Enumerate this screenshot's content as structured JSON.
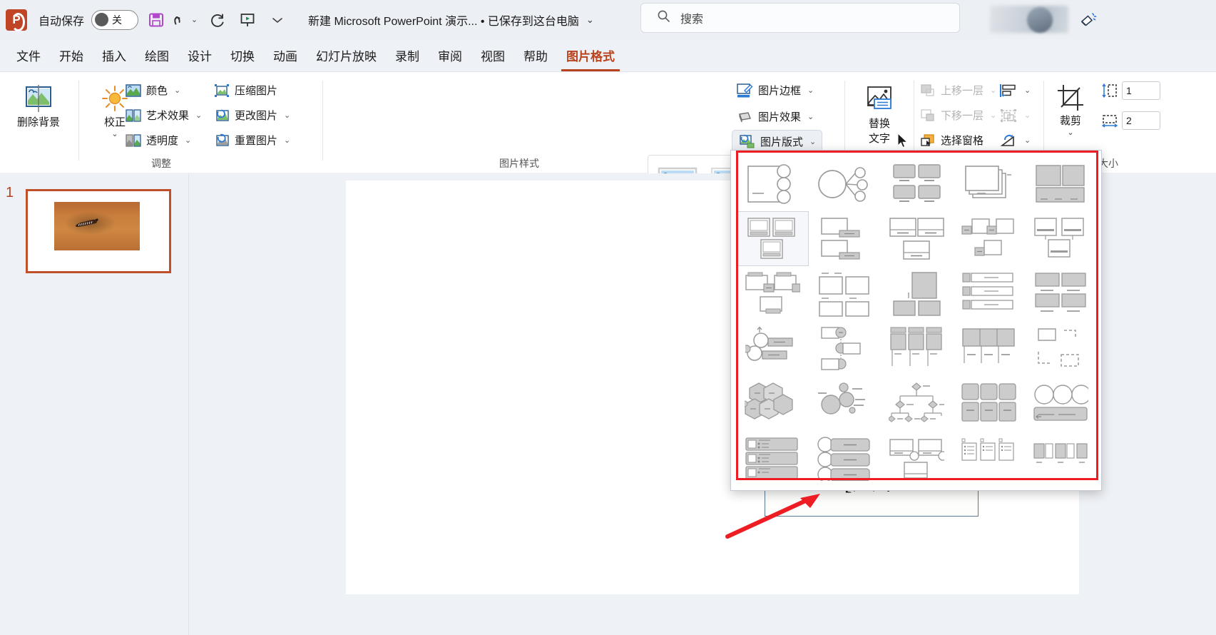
{
  "titlebar": {
    "app_logo": "powerpoint-logo",
    "autosave_label": "自动保存",
    "autosave_state": "关",
    "save_icon": "save-icon",
    "undo_icon": "undo-icon",
    "redo_icon": "redo-icon",
    "present_icon": "start-presentation-icon",
    "customize_icon": "customize-quick-access-icon",
    "document_title": "新建 Microsoft PowerPoint 演示... • 已保存到这台电脑",
    "title_caret": "chevron-down-icon",
    "account_icon": "account-avatar",
    "megaphone_icon": "announcements-icon"
  },
  "search": {
    "placeholder": "搜索",
    "icon": "search-icon"
  },
  "tabs": [
    {
      "label": "文件",
      "active": false
    },
    {
      "label": "开始",
      "active": false
    },
    {
      "label": "插入",
      "active": false
    },
    {
      "label": "绘图",
      "active": false
    },
    {
      "label": "设计",
      "active": false
    },
    {
      "label": "切换",
      "active": false
    },
    {
      "label": "动画",
      "active": false
    },
    {
      "label": "幻灯片放映",
      "active": false
    },
    {
      "label": "录制",
      "active": false
    },
    {
      "label": "审阅",
      "active": false
    },
    {
      "label": "视图",
      "active": false
    },
    {
      "label": "帮助",
      "active": false
    },
    {
      "label": "图片格式",
      "active": true
    }
  ],
  "ribbon": {
    "groups": {
      "adjust": {
        "title": "调整",
        "remove_bg": "删除背景",
        "corrections": "校正",
        "color": "颜色",
        "artistic_effects": "艺术效果",
        "transparency": "透明度",
        "compress": "压缩图片",
        "change_picture": "更改图片",
        "reset_picture": "重置图片"
      },
      "picture_styles": {
        "title": "图片样式",
        "picture_border": "图片边框",
        "picture_effects": "图片效果",
        "picture_layout": "图片版式",
        "scroll_up": "scroll-up-icon",
        "scroll_down": "scroll-down-icon",
        "more": "more-styles-icon"
      },
      "accessibility": {
        "alt_text_line1": "替换",
        "alt_text_line2": "文字"
      },
      "arrange": {
        "bring_forward": "上移一层",
        "send_backward": "下移一层",
        "selection_pane": "选择窗格",
        "align": "align-icon",
        "group": "group-icon",
        "rotate": "rotate-icon"
      },
      "size": {
        "title_partial": "大小",
        "crop_label": "裁剪",
        "height_value": "1",
        "width_value": "2",
        "height_icon": "shape-height-icon",
        "width_icon": "shape-width-icon"
      }
    }
  },
  "thumbnails": {
    "slides": [
      {
        "number": "1",
        "selected": true,
        "image": "zebra-photo"
      }
    ]
  },
  "slide": {
    "picture_layout_text": "[文本",
    "image": "zebra-photo"
  },
  "dropdown": {
    "name": "picture-layout-gallery",
    "selected_index": 5,
    "layouts": [
      "accented-picture",
      "bending-picture-blocks",
      "bubble-picture-list",
      "captioned-pictures",
      "circular-picture-callout",
      "continuous-picture-list",
      "descending-picture-callout",
      "framed-picture",
      "hexagon-picture",
      "picture-accent-blocks",
      "picture-accent-list",
      "picture-accent-process",
      "picture-caption-list",
      "picture-grid",
      "picture-lineup",
      "picture-organization-chart",
      "picture-strips",
      "radial-picture-list",
      "snapshot-picture-list",
      "spiral-picture",
      "alternating-picture-blocks",
      "alternating-picture-circles",
      "bubble-picture-grid",
      "captioned-picture-row",
      "circle-picture-hierarchy",
      "titled-picture-accent-list",
      "title-picture-lineup",
      "vertical-picture-list",
      "vertical-picture-accent-list",
      "theme-picture-grid"
    ]
  },
  "annotation": {
    "highlight_color": "#ee1d24",
    "arrow_color": "#ee1d24"
  },
  "colors": {
    "accent": "#b8431f",
    "ribbon_bg": "#ffffff",
    "titlebar_bg": "#eceff3",
    "canvas_bg": "#eef1f5"
  }
}
